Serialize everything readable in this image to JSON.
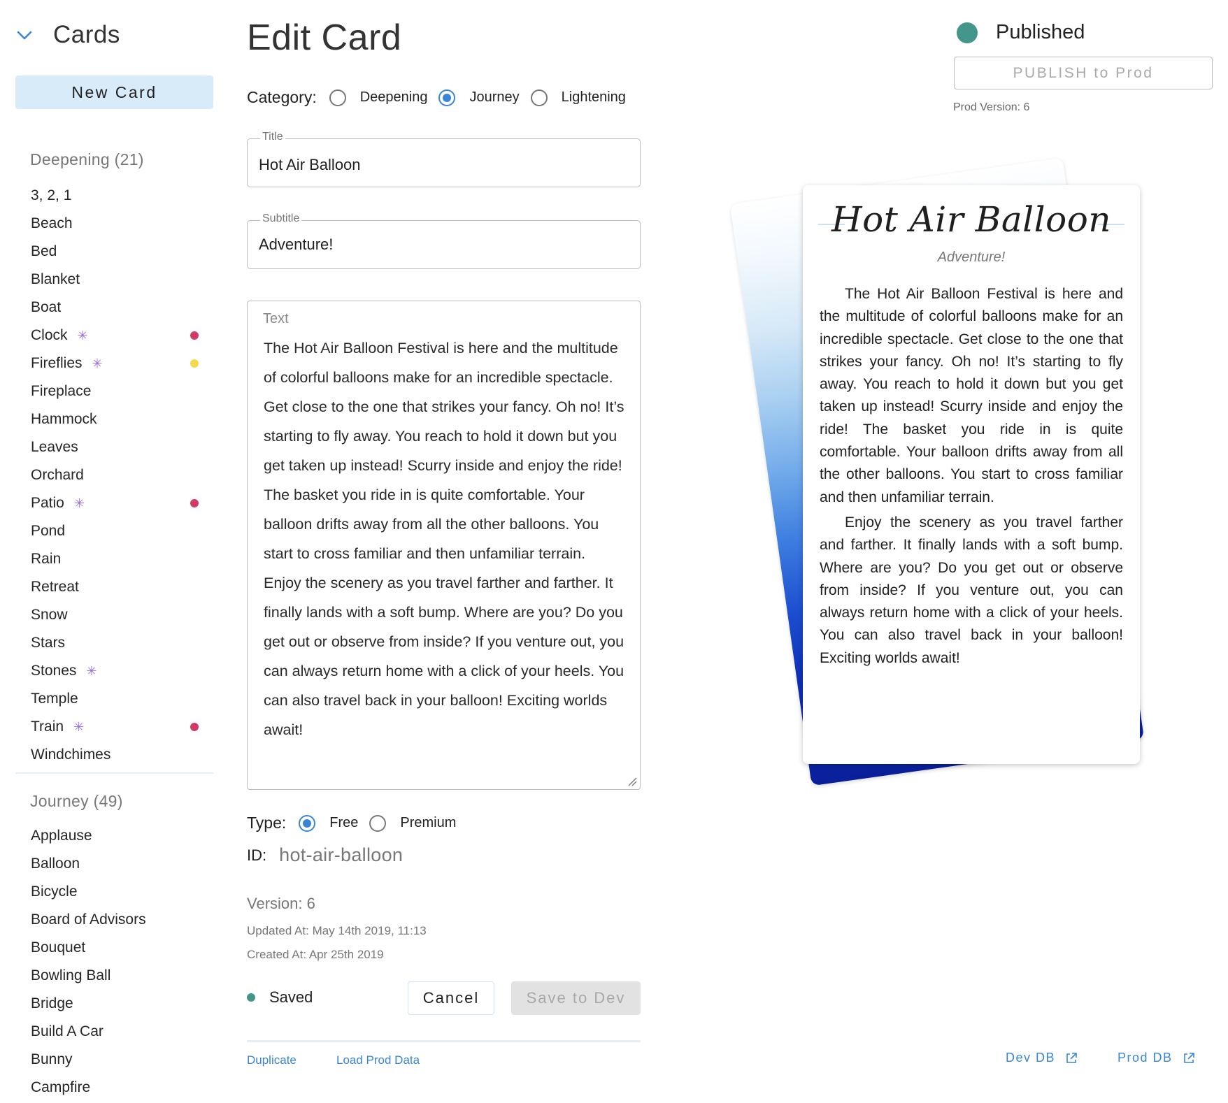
{
  "sidebar": {
    "header_title": "Cards",
    "new_card_label": "New Card",
    "groups": [
      {
        "title": "Deepening (21)",
        "items": [
          {
            "label": "3, 2, 1"
          },
          {
            "label": "Beach"
          },
          {
            "label": "Bed"
          },
          {
            "label": "Blanket"
          },
          {
            "label": "Boat"
          },
          {
            "label": "Clock",
            "star": true,
            "dot": "#d23b63"
          },
          {
            "label": "Fireflies",
            "star": true,
            "dot": "#f5d94a"
          },
          {
            "label": "Fireplace"
          },
          {
            "label": "Hammock"
          },
          {
            "label": "Leaves"
          },
          {
            "label": "Orchard"
          },
          {
            "label": "Patio",
            "star": true,
            "dot": "#d23b63"
          },
          {
            "label": "Pond"
          },
          {
            "label": "Rain"
          },
          {
            "label": "Retreat"
          },
          {
            "label": "Snow"
          },
          {
            "label": "Stars"
          },
          {
            "label": "Stones",
            "star": true
          },
          {
            "label": "Temple"
          },
          {
            "label": "Train",
            "star": true,
            "dot": "#d23b63"
          },
          {
            "label": "Windchimes"
          }
        ]
      },
      {
        "title": "Journey (49)",
        "items": [
          {
            "label": "Applause"
          },
          {
            "label": "Balloon"
          },
          {
            "label": "Bicycle"
          },
          {
            "label": "Board of Advisors"
          },
          {
            "label": "Bouquet"
          },
          {
            "label": "Bowling Ball"
          },
          {
            "label": "Bridge"
          },
          {
            "label": "Build A Car"
          },
          {
            "label": "Bunny"
          },
          {
            "label": "Campfire"
          }
        ]
      }
    ],
    "star_glyph": "✳",
    "colors": {
      "selected_button_bg": "#d8ebf8"
    }
  },
  "editor": {
    "heading": "Edit Card",
    "category": {
      "label": "Category:",
      "options": [
        "Deepening",
        "Journey",
        "Lightening"
      ],
      "selected": "Journey"
    },
    "title_field": {
      "label": "Title",
      "value": "Hot Air Balloon"
    },
    "subtitle_field": {
      "label": "Subtitle",
      "value": "Adventure!"
    },
    "text_field": {
      "label": "Text",
      "paragraphs": [
        "The Hot Air Balloon Festival is here and the multitude of colorful balloons make for an incredible spectacle. Get close to the one that strikes your fancy. Oh no! It’s starting to fly away. You reach to hold it down but you get taken up instead! Scurry inside and enjoy the ride! The basket you ride in is quite comfortable. Your balloon drifts away from all the other balloons. You start to cross familiar and then unfamiliar terrain.",
        "Enjoy the scenery as you travel farther and farther. It finally lands with a soft bump. Where are you? Do you get out or observe from inside? If you venture out, you can always return home with a click of your heels. You can also travel back in your balloon! Exciting worlds await!"
      ]
    },
    "type": {
      "label": "Type:",
      "options": [
        "Free",
        "Premium"
      ],
      "selected": "Free"
    },
    "id": {
      "label": "ID:",
      "value": "hot-air-balloon"
    },
    "version": "Version: 6",
    "updated_at": "Updated At: May 14th 2019, 11:13",
    "created_at": "Created At: Apr 25th 2019",
    "status": "Saved",
    "cancel_label": "Cancel",
    "save_label": "Save to Dev",
    "duplicate_label": "Duplicate",
    "load_prod_label": "Load Prod Data"
  },
  "publish": {
    "status": "Published",
    "status_color": "#45968a",
    "button_label": "PUBLISH to Prod",
    "prod_version": "Prod Version: 6"
  },
  "preview": {
    "title": "Hot Air Balloon",
    "subtitle": "Adventure!"
  },
  "footer_links": {
    "dev_db": "Dev DB",
    "prod_db": "Prod DB"
  },
  "colors": {
    "accent": "#3a86d6",
    "status_green": "#45968a",
    "divider": "#e3eef6"
  }
}
